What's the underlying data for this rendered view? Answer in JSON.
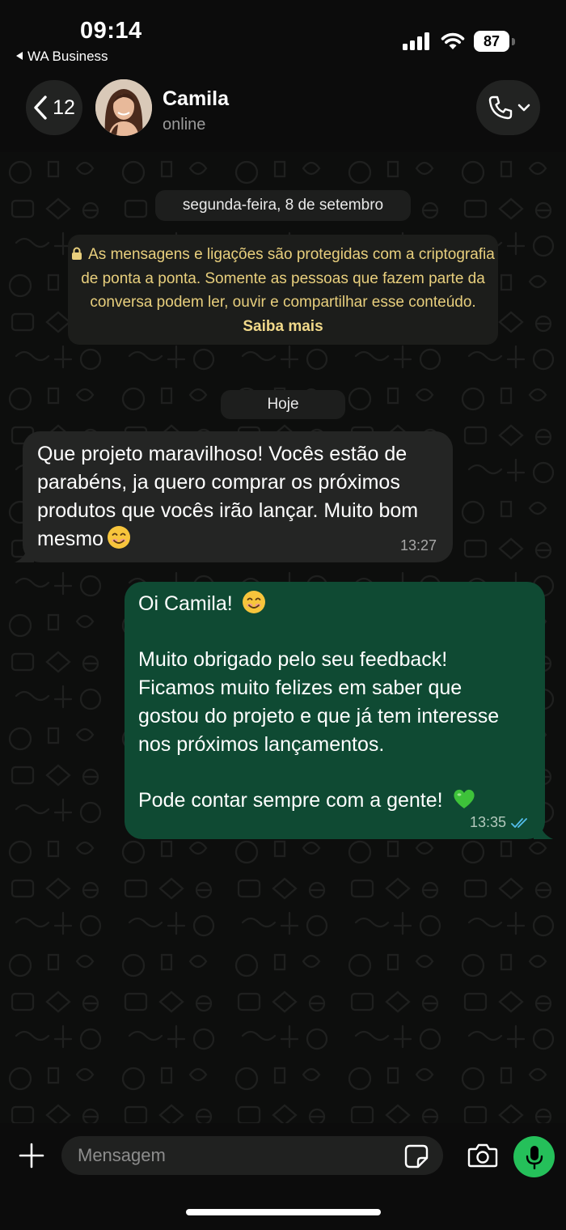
{
  "status_bar": {
    "time": "09:14",
    "back_app": "WA Business",
    "battery": "87"
  },
  "header": {
    "back_count": "12",
    "contact_name": "Camila",
    "contact_status": "online",
    "back_icon": "chevron-left-icon",
    "call_icon": "phone-icon"
  },
  "chat": {
    "date_label": "segunda-feira, 8 de setembro",
    "encryption_notice": {
      "text": "As mensagens e ligações são protegidas com a criptografia de ponta a ponta. Somente as pessoas que fazem parte da conversa podem ler, ouvir e compartilhar esse conteúdo.",
      "link": "Saiba mais"
    },
    "today_label": "Hoje",
    "messages": [
      {
        "direction": "incoming",
        "text": "Que projeto maravilhoso! Vocês estão de parabéns, ja quero comprar os próximos produtos que vocês irão lançar. Muito bom mesmo",
        "emoji": "😊",
        "time": "13:27"
      },
      {
        "direction": "outgoing",
        "greeting": "Oi Camila!",
        "greeting_emoji": "😊",
        "body_lines": [
          "Muito obrigado pelo seu feedback!",
          "Ficamos muito felizes em saber que",
          "gostou do projeto e que já tem interesse",
          "nos próximos lançamentos."
        ],
        "closing": "Pode contar sempre com a gente!",
        "closing_emoji": "💚",
        "time": "13:35",
        "read_receipt": "double-check-icon"
      }
    ]
  },
  "composer": {
    "placeholder": "Mensagem"
  },
  "colors": {
    "outgoing_bubble": "#0f4a33",
    "incoming_bubble": "#242524",
    "notice_text": "#e8cf7d",
    "mic_button": "#25c05a",
    "read_receipt": "#53bdeb"
  }
}
